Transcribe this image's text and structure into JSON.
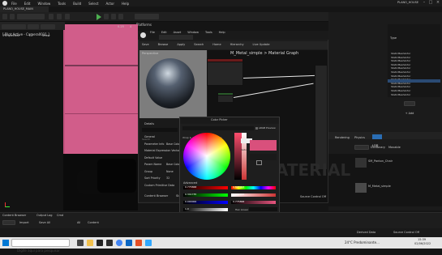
{
  "app": {
    "project": "PLANO_HOUSE",
    "level": "PLANO_HOUSE_MAIN",
    "menu": [
      "File",
      "Edit",
      "Window",
      "Tools",
      "Build",
      "Select",
      "Actor",
      "Help"
    ],
    "window_controls": [
      "–",
      "□",
      "×"
    ]
  },
  "toolbar": {
    "select_mode": "Select Mode",
    "platforms": "Platforms",
    "settings": "Settings"
  },
  "viewport": {
    "perspective": "Perspective",
    "lit": "Lit",
    "show": "Show",
    "pilot": "[ Pilot Active - Camera0011 ]",
    "scale": "0.25",
    "speed": "4"
  },
  "material_editor": {
    "window_title": "M_Metal_simple",
    "menu": [
      "File",
      "Edit",
      "Asset",
      "Window",
      "Tools",
      "Help"
    ],
    "toolbar": [
      "Save",
      "Browse",
      "Apply",
      "Search",
      "Home",
      "Hierarchy",
      "Live Update"
    ],
    "breadcrumb": "M_Metal_simple > Material Graph",
    "viewport_label": "Perspective",
    "details_tab": "Details",
    "details_search": "Search",
    "details_labels": [
      "General",
      "Parameter Info",
      "Material Expression Vector Param",
      "Default Value",
      "Param Name",
      "Group",
      "Sort Priority",
      "Custom Primitive Data"
    ],
    "details_values": [
      "",
      "Base Color",
      "",
      "",
      "Base Color",
      "None",
      "32",
      ""
    ],
    "bottom_tabs": [
      "Content Browser",
      "Stats",
      "Source Control Off"
    ],
    "watermark": "MATERIAL"
  },
  "color_picker": {
    "title": "Color Picker",
    "mode": "Wrap & drop colors here to save",
    "srgb": "sRGB Preview",
    "saturation_label": "Saturation",
    "advanced": "Advanced",
    "hex_linear_label": "Hex Linear",
    "hex_srgb_label": "Hex sRGB",
    "hex_linear": "EA1D5CFF",
    "hex_srgb": "D9507CFF",
    "ok": "OK",
    "cancel": "Cancel",
    "channel_values": [
      "0.775868",
      "0.341735",
      "0.000000",
      "1.0",
      "0.827043",
      "0.999995",
      "0.775868"
    ]
  },
  "right_panel": {
    "outliner_header": "Type",
    "outliner_rows": [
      "StaticMeshActor",
      "StaticMeshActor",
      "StaticMeshActor",
      "StaticMeshActor",
      "StaticMeshActor",
      "StaticMeshActor",
      "StaticMeshActor",
      "StaticMeshActor",
      "StaticMeshActor",
      "StaticMeshActor",
      "StaticMeshActor",
      "StaticMeshActor"
    ],
    "add_button": "+ Add",
    "tabs": [
      "Rendering",
      "Physics",
      "LOD"
    ],
    "subtabs": [
      "Static",
      "Dictionary",
      "Movable"
    ],
    "asset1": "SM_Panton_Chair",
    "asset2": "M_Metal_simple"
  },
  "content_browser": {
    "title": "Content Browser",
    "tabs": [
      "Output Log",
      "Cmd"
    ],
    "add": "+ Add",
    "import": "Import",
    "save_all": "Save All",
    "all": "All",
    "path": "Content"
  },
  "statusbar": {
    "derived": "Derived Data",
    "source": "Source Control Off"
  },
  "taskbar": {
    "search_placeholder": "Digite aqui para pesquisar",
    "weather": "24°C  Predominante...",
    "time": "15:39",
    "date": "02/06/2022"
  },
  "colors": {
    "accent_pink": "#D9507C",
    "ue_dark": "#1C1C1C"
  }
}
